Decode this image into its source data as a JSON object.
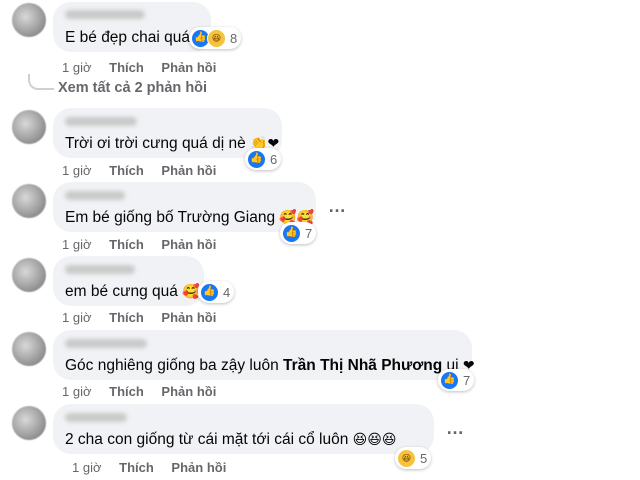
{
  "comments": [
    {
      "text": "E bé đẹp chai quá",
      "suffix_emoji": "",
      "reaction_count": "8",
      "time": "1 giờ",
      "like": "Thích",
      "reply": "Phản hồi"
    },
    {
      "text": "Trời ơi trời cưng quá dị nè",
      "suffix_emoji": "👏❤",
      "reaction_count": "6",
      "time": "1 giờ",
      "like": "Thích",
      "reply": "Phản hồi"
    },
    {
      "text": "Em bé giống bố Trường Giang",
      "suffix_emoji": "🥰🥰",
      "reaction_count": "7",
      "time": "1 giờ",
      "like": "Thích",
      "reply": "Phản hồi"
    },
    {
      "text": "em bé cưng quá",
      "suffix_emoji": "🥰",
      "reaction_count": "4",
      "time": "1 giờ",
      "like": "Thích",
      "reply": "Phản hồi"
    },
    {
      "text_before": "Góc nghiêng giống ba zậy luôn",
      "mention": "Trần Thị Nhã Phương",
      "text_after": "ui",
      "suffix_emoji": "❤",
      "reaction_count": "7",
      "time": "1 giờ",
      "like": "Thích",
      "reply": "Phản hồi"
    },
    {
      "text": "2 cha con giống từ cái mặt tới cái cổ luôn",
      "suffix_emoji": "😆😆😆",
      "reaction_count": "5",
      "time": "1 giờ",
      "like": "Thích",
      "reply": "Phản hồi"
    }
  ],
  "view_replies": "Xem tất cả 2 phản hồi",
  "more_icon": "…",
  "icons": {
    "like": "👍",
    "haha": "😆",
    "love": "♥"
  },
  "colors": {
    "bubble": "#f0f2f5",
    "secondary_text": "#65676b",
    "like_blue": "#1877f2"
  }
}
